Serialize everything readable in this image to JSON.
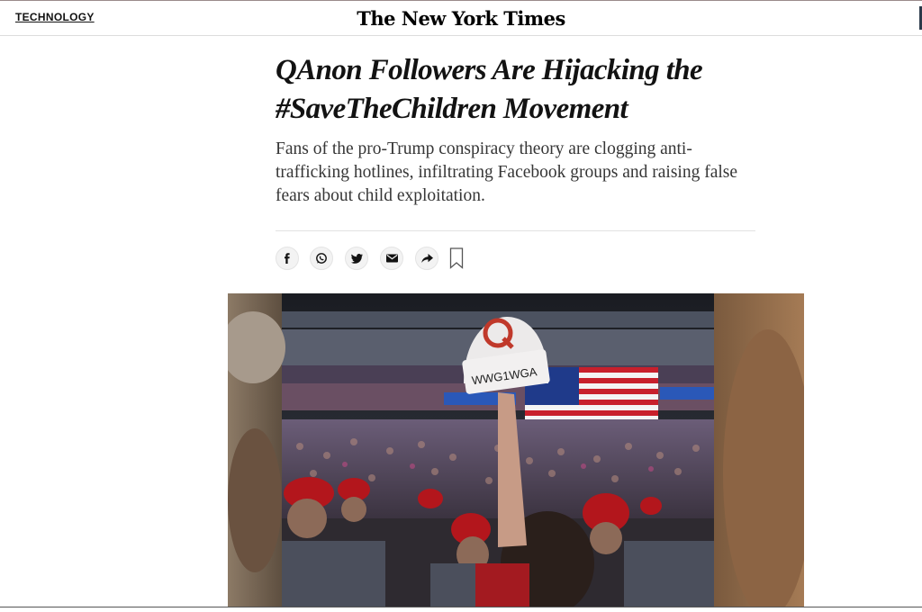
{
  "header": {
    "section_label": "TECHNOLOGY",
    "masthead": "The New York Times"
  },
  "article": {
    "headline": "QAnon Followers Are Hijacking the #SaveTheChildren Movement",
    "summary": "Fans of the pro-Trump conspiracy theory are clogging anti-trafficking hotlines, infiltrating Facebook groups and raising false fears about child exploitation."
  },
  "share_bar": {
    "buttons": [
      {
        "name": "facebook",
        "icon": "facebook-icon"
      },
      {
        "name": "whatsapp",
        "icon": "whatsapp-icon"
      },
      {
        "name": "twitter",
        "icon": "twitter-icon"
      },
      {
        "name": "email",
        "icon": "email-icon"
      },
      {
        "name": "share",
        "icon": "share-arrow-icon"
      },
      {
        "name": "save",
        "icon": "bookmark-icon"
      }
    ]
  },
  "photo": {
    "hat_text": "WWG1WGA",
    "hat_letter": "Q"
  },
  "colors": {
    "text": "#121212",
    "summary_text": "#363636",
    "cap_red": "#b3161c",
    "flag_blue": "#1f3a8a"
  }
}
